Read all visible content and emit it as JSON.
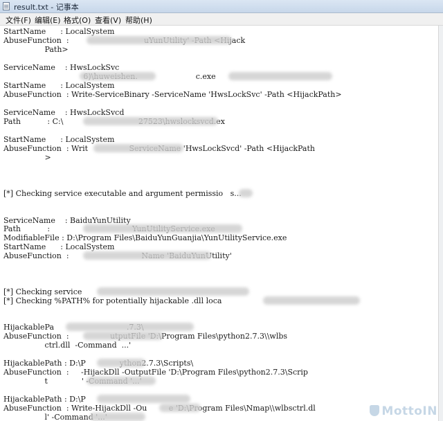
{
  "window": {
    "title": "result.txt - 记事本"
  },
  "menu": [
    "文件(F)",
    "编辑(E)",
    "格式(O)",
    "查看(V)",
    "帮助(H)"
  ],
  "lines": [
    "StartName      : LocalSystem",
    "AbuseFunction  :                               uYunUtility' -Path <Hijack",
    "                 Path>",
    "ServiceName    : HwsLockSvc",
    "                                 6)\\huweishen.                        c.exe",
    "StartName      : LocalSystem",
    "AbuseFunction  : Write-ServiceBinary -ServiceName 'HwsLockSvc' -Path <HijackPath>",
    "ServiceName    : HwsLockSvcd",
    "Path           : C:\\                               27523\\hwslocksvcd.ex",
    "StartName      : LocalSystem",
    "AbuseFunction  : Writ                 ServiceName 'HwsLockSvcd' -Path <HijackPath",
    "                 >",
    "[*] Checking service executable and argument permissio   s...",
    "ServiceName    : BaiduYunUtility",
    "Path           :                                  YunUtilityService.exe",
    "ModifiableFile : D:\\Program Files\\BaiduYunGuanjia\\YunUtilityService.exe",
    "StartName      : LocalSystem",
    "AbuseFunction  :                              Name 'BaiduYunUtility'",
    "[*] Checking service",
    "[*] Checking %PATH% for potentially hijackable .dll loca",
    "HijackablePa                              .7.3\\",
    "AbuseFunction  :                 utputFile 'D:\\Program Files\\python2.7.3\\\\wlbs",
    "                 ctrl.dll  -Command  ...'",
    "HijackablePath : D:\\P              ython2.7.3\\Scripts\\",
    "AbuseFunction  :     -HijackDll -OutputFile 'D:\\Program Files\\python2.7.3\\Scrip",
    "                 t              ' -Command '...'",
    "HijackablePath : D:\\P",
    "AbuseFunction  : Write-HijackDll -Ou         e 'D:\\Program Files\\Nmap\\\\wlbsctrl.dl",
    "                 l' -Command '...'"
  ],
  "watermark": "MottoIN"
}
